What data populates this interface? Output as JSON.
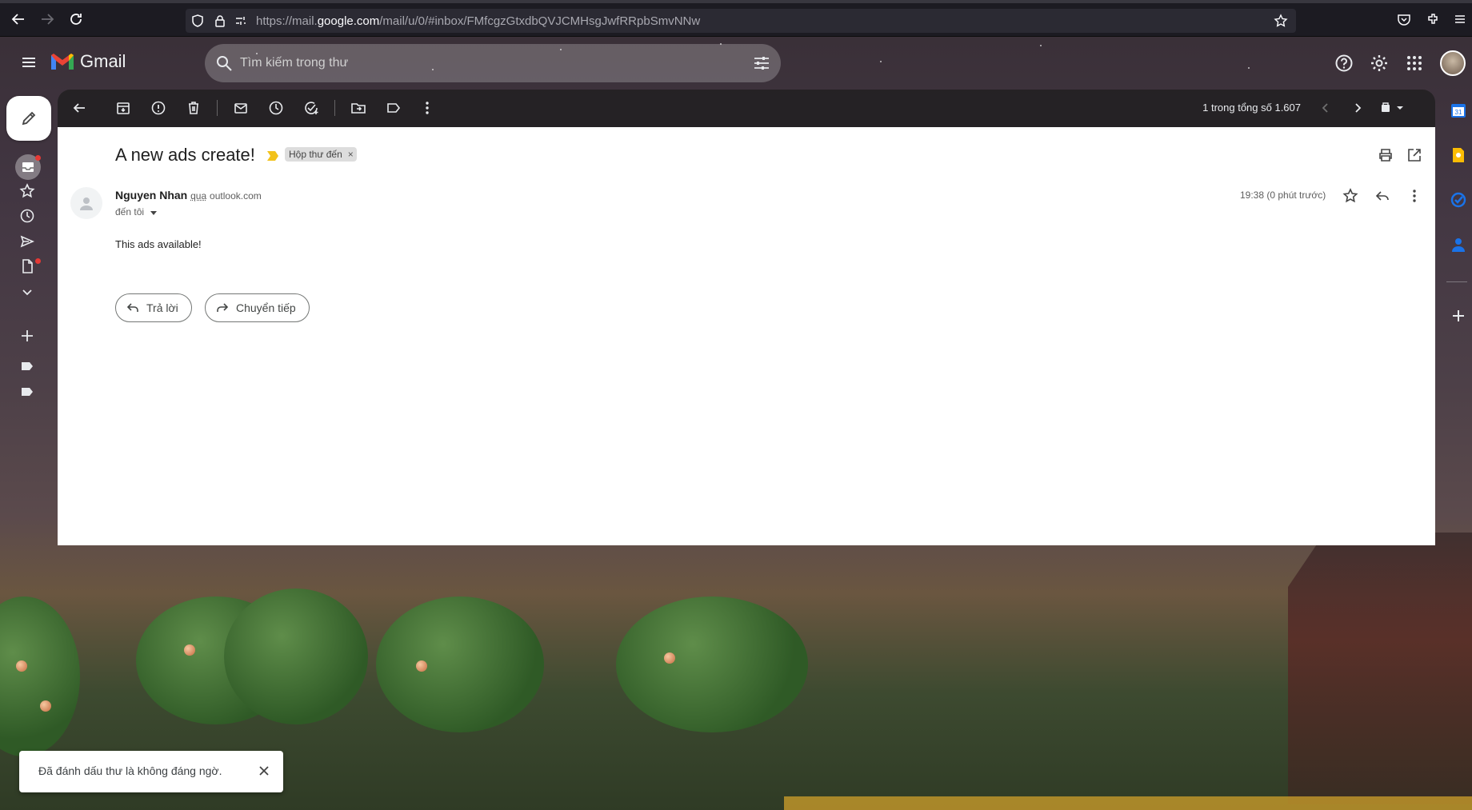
{
  "browser": {
    "url_prefix": "https://mail.",
    "url_host": "google.com",
    "url_path": "/mail/u/0/#inbox/FMfcgzGtxdbQVJCMHsgJwfRRpbSmvNNw"
  },
  "header": {
    "logo_text": "Gmail",
    "search_placeholder": "Tìm kiếm trong thư"
  },
  "toolbar": {
    "pager_text": "1 trong tổng số 1.607"
  },
  "email": {
    "subject": "A new ads create!",
    "label": "Hộp thư đến",
    "label_remove": "×",
    "sender_name": "Nguyen Nhan",
    "via_text": "qua",
    "sender_domain": "outlook.com",
    "to_text": "đến tôi",
    "time": "19:38 (0 phút trước)",
    "body": "This ads available!",
    "reply_label": "Trả lời",
    "forward_label": "Chuyển tiếp"
  },
  "snackbar": {
    "message": "Đã đánh dấu thư là không đáng ngờ."
  },
  "colors": {
    "accent_red": "#e53935",
    "chip_bg": "#dddddd",
    "important_marker": "#f2c21b"
  }
}
